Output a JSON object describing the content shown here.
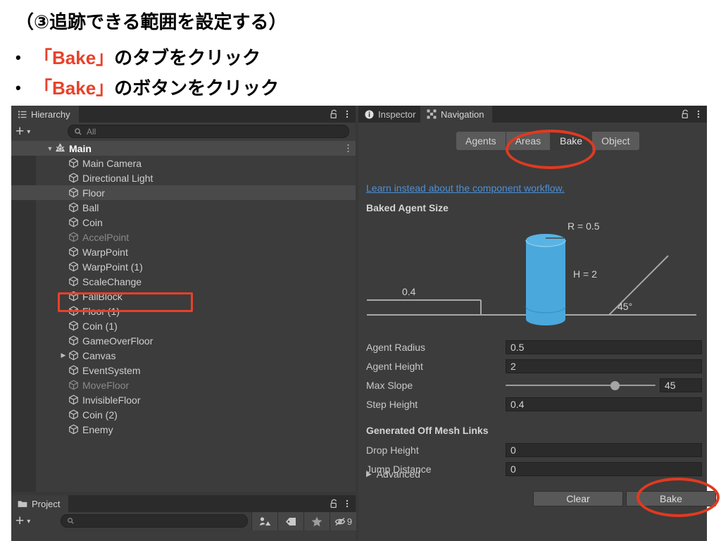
{
  "slide": {
    "title": "（③追跡できる範囲を設定する）",
    "bullets": [
      {
        "marker": "•",
        "highlight": "「Bake」",
        "rest": "のタブをクリック"
      },
      {
        "marker": "•",
        "highlight": "「Bake」",
        "rest": "のボタンをクリック"
      }
    ],
    "highlight_color": "#e8412a"
  },
  "hierarchy": {
    "tab_label": "Hierarchy",
    "tab_icon": "hierarchy-icon",
    "lock_icon": "lock-open-icon",
    "menu_icon": "kebab-menu-icon",
    "add_button_label": "+",
    "add_dropdown_label": "▾",
    "search_placeholder": "All",
    "search_value": "",
    "search_icon": "search-icon",
    "items": [
      {
        "label": "Main",
        "depth": 0,
        "expanded": true,
        "root": true,
        "dim": false,
        "selected": false,
        "kebab": true
      },
      {
        "label": "Main Camera",
        "depth": 1,
        "dim": false,
        "selected": false
      },
      {
        "label": "Directional Light",
        "depth": 1,
        "dim": false,
        "selected": false
      },
      {
        "label": "Floor",
        "depth": 1,
        "dim": false,
        "selected": true
      },
      {
        "label": "Ball",
        "depth": 1,
        "dim": false,
        "selected": false
      },
      {
        "label": "Coin",
        "depth": 1,
        "dim": false,
        "selected": false
      },
      {
        "label": "AccelPoint",
        "depth": 1,
        "dim": true,
        "selected": false
      },
      {
        "label": "WarpPoint",
        "depth": 1,
        "dim": false,
        "selected": false
      },
      {
        "label": "WarpPoint (1)",
        "depth": 1,
        "dim": false,
        "selected": false
      },
      {
        "label": "ScaleChange",
        "depth": 1,
        "dim": false,
        "selected": false
      },
      {
        "label": "FallBlock",
        "depth": 1,
        "dim": false,
        "selected": false
      },
      {
        "label": "Floor (1)",
        "depth": 1,
        "dim": false,
        "selected": false
      },
      {
        "label": "Coin (1)",
        "depth": 1,
        "dim": false,
        "selected": false
      },
      {
        "label": "GameOverFloor",
        "depth": 1,
        "dim": false,
        "selected": false
      },
      {
        "label": "Canvas",
        "depth": 1,
        "dim": false,
        "selected": false,
        "collapsed": true
      },
      {
        "label": "EventSystem",
        "depth": 1,
        "dim": false,
        "selected": false
      },
      {
        "label": "MoveFloor",
        "depth": 1,
        "dim": true,
        "selected": false
      },
      {
        "label": "InvisibleFloor",
        "depth": 1,
        "dim": false,
        "selected": false
      },
      {
        "label": "Coin (2)",
        "depth": 1,
        "dim": false,
        "selected": false
      },
      {
        "label": "Enemy",
        "depth": 1,
        "dim": false,
        "selected": false
      }
    ]
  },
  "project": {
    "tab_label": "Project",
    "tab_icon": "folder-icon",
    "lock_icon": "lock-open-icon",
    "menu_icon": "kebab-menu-icon",
    "add_button_label": "+",
    "add_dropdown_label": "▾",
    "search_placeholder": "",
    "search_icon": "search-icon",
    "buttons": [
      {
        "icon": "avatar-filter-icon",
        "label": ""
      },
      {
        "icon": "label-tag-icon",
        "label": ""
      },
      {
        "icon": "star-favorite-icon",
        "label": ""
      },
      {
        "icon": "hidden-eye-icon",
        "label": "9"
      }
    ]
  },
  "inspector": {
    "tabs": [
      {
        "label": "Inspector",
        "icon": "info-icon",
        "active": false
      },
      {
        "label": "Navigation",
        "icon": "navigation-icon",
        "active": true
      }
    ],
    "lock_icon": "lock-open-icon",
    "menu_icon": "kebab-menu-icon",
    "mode_buttons": [
      {
        "label": "Agents",
        "selected": false
      },
      {
        "label": "Areas",
        "selected": false
      },
      {
        "label": "Bake",
        "selected": true
      },
      {
        "label": "Object",
        "selected": false
      }
    ],
    "learn_link": "Learn instead about the component workflow.",
    "baked_agent_size_header": "Baked Agent Size",
    "diagram": {
      "radius_label": "R = 0.5",
      "height_label": "H = 2",
      "step_label": "0.4",
      "slope_label": "45°",
      "cylinder_color": "#4aa8dd"
    },
    "fields": [
      {
        "label": "Agent Radius",
        "value": "0.5",
        "type": "text"
      },
      {
        "label": "Agent Height",
        "value": "2",
        "type": "text"
      },
      {
        "label": "Max Slope",
        "value": "45",
        "type": "slider",
        "slider_percent": 73
      },
      {
        "label": "Step Height",
        "value": "0.4",
        "type": "text"
      }
    ],
    "offmesh_header": "Generated Off Mesh Links",
    "offmesh_fields": [
      {
        "label": "Drop Height",
        "value": "0",
        "type": "text"
      },
      {
        "label": "Jump Distance",
        "value": "0",
        "type": "text"
      }
    ],
    "advanced_label": "Advanced",
    "advanced_arrow": "▶",
    "clear_button": "Clear",
    "bake_button": "Bake"
  },
  "annotations": {
    "color": "#e03a20",
    "floor_rect": "floor-row-highlight",
    "bake_tab_ellipse": "bake-tab-highlight",
    "bake_button_ellipse": "bake-button-highlight"
  }
}
